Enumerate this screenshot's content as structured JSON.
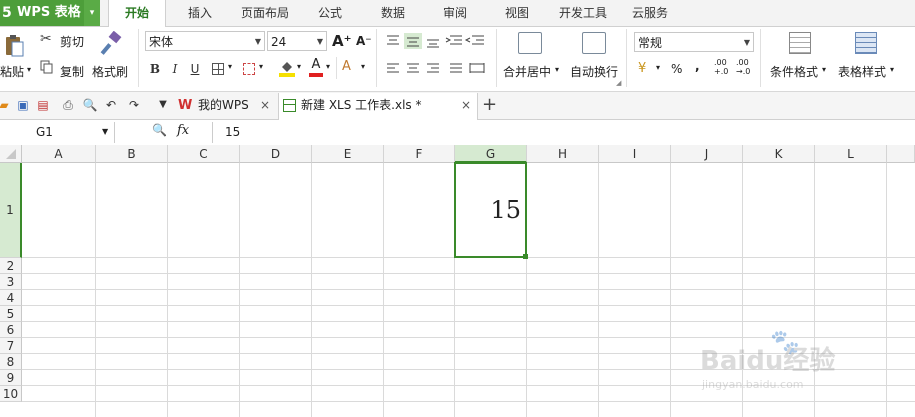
{
  "app": {
    "logo": "5",
    "name": "WPS 表格",
    "menu_arrow": "▾"
  },
  "menu_tabs": [
    "开始",
    "插入",
    "页面布局",
    "公式",
    "数据",
    "审阅",
    "视图",
    "开发工具",
    "云服务"
  ],
  "ribbon": {
    "paste": "粘贴",
    "cut": "剪切",
    "copy": "复制",
    "format_painter": "格式刷",
    "font_name": "宋体",
    "font_size": "24",
    "grow_font": "A⁺",
    "shrink_font": "A⁻",
    "bold": "B",
    "italic": "I",
    "underline": "U",
    "merge_center": "合并居中",
    "wrap_text": "自动换行",
    "number_format": "常规",
    "percent": "%",
    "comma": ",",
    "inc_decimal": ".00\n+.0",
    "dec_decimal": ".00\n→.0",
    "conditional_format": "条件格式",
    "table_style": "表格样式"
  },
  "doc_tabs": [
    {
      "label": "我的WPS",
      "close": "×"
    },
    {
      "label": "新建 XLS 工作表.xls *",
      "close": "×"
    }
  ],
  "new_tab": "+",
  "formula_bar": {
    "name_box": "G1",
    "zoom_icon": "🔍",
    "fx": "fx",
    "content": "15"
  },
  "columns": [
    "A",
    "B",
    "C",
    "D",
    "E",
    "F",
    "G",
    "H",
    "I",
    "J",
    "K",
    "L"
  ],
  "rows": [
    "1",
    "2",
    "3",
    "4",
    "5",
    "6",
    "7",
    "8",
    "9",
    "10"
  ],
  "cells": {
    "G1": "15"
  },
  "selected_cell": "G1",
  "watermark": {
    "brand": "Baidu经验",
    "url": "jingyan.baidu.com"
  },
  "colors": {
    "accent": "#4d9e3a",
    "selection": "#3a8a2a",
    "header_selected": "#d6ead1"
  }
}
